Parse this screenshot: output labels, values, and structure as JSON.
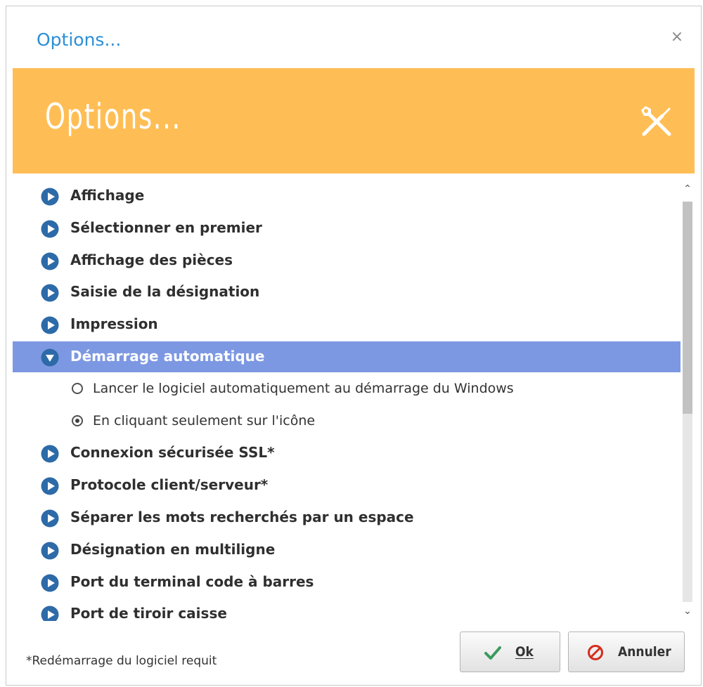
{
  "window": {
    "title": "Options...",
    "close_symbol": "×"
  },
  "banner": {
    "title": "Options...",
    "icon": "tools-icon",
    "background": "#ffbe55"
  },
  "list": {
    "items": [
      {
        "label": "Affichage",
        "state": "collapsed"
      },
      {
        "label": "Sélectionner en premier",
        "state": "collapsed"
      },
      {
        "label": "Affichage des pièces",
        "state": "collapsed"
      },
      {
        "label": "Saisie de la désignation",
        "state": "collapsed"
      },
      {
        "label": "Impression",
        "state": "collapsed"
      },
      {
        "label": "Démarrage automatique",
        "state": "expanded",
        "selected": true,
        "options": [
          {
            "label": "Lancer le logiciel automatiquement au démarrage du Windows",
            "checked": false
          },
          {
            "label": "En cliquant seulement sur l'icône",
            "checked": true
          }
        ]
      },
      {
        "label": "Connexion sécurisée SSL*",
        "state": "collapsed"
      },
      {
        "label": "Protocole client/serveur*",
        "state": "collapsed"
      },
      {
        "label": "Séparer les mots recherchés par un espace",
        "state": "collapsed"
      },
      {
        "label": "Désignation en multiligne",
        "state": "collapsed"
      },
      {
        "label": "Port du terminal code à barres",
        "state": "collapsed"
      },
      {
        "label": "Port de tiroir caisse",
        "state": "collapsed"
      }
    ],
    "selected_color": "#7d98e2",
    "bullet_color": "#2d6aa8"
  },
  "footer": {
    "note": "*Redémarrage du logiciel requit"
  },
  "buttons": {
    "ok_label": "Ok",
    "cancel_label": "Annuler",
    "ok_icon": "checkmark-icon",
    "cancel_icon": "prohibited-icon",
    "ok_icon_color": "#3a9a5e",
    "cancel_icon_color": "#d62c1e"
  }
}
